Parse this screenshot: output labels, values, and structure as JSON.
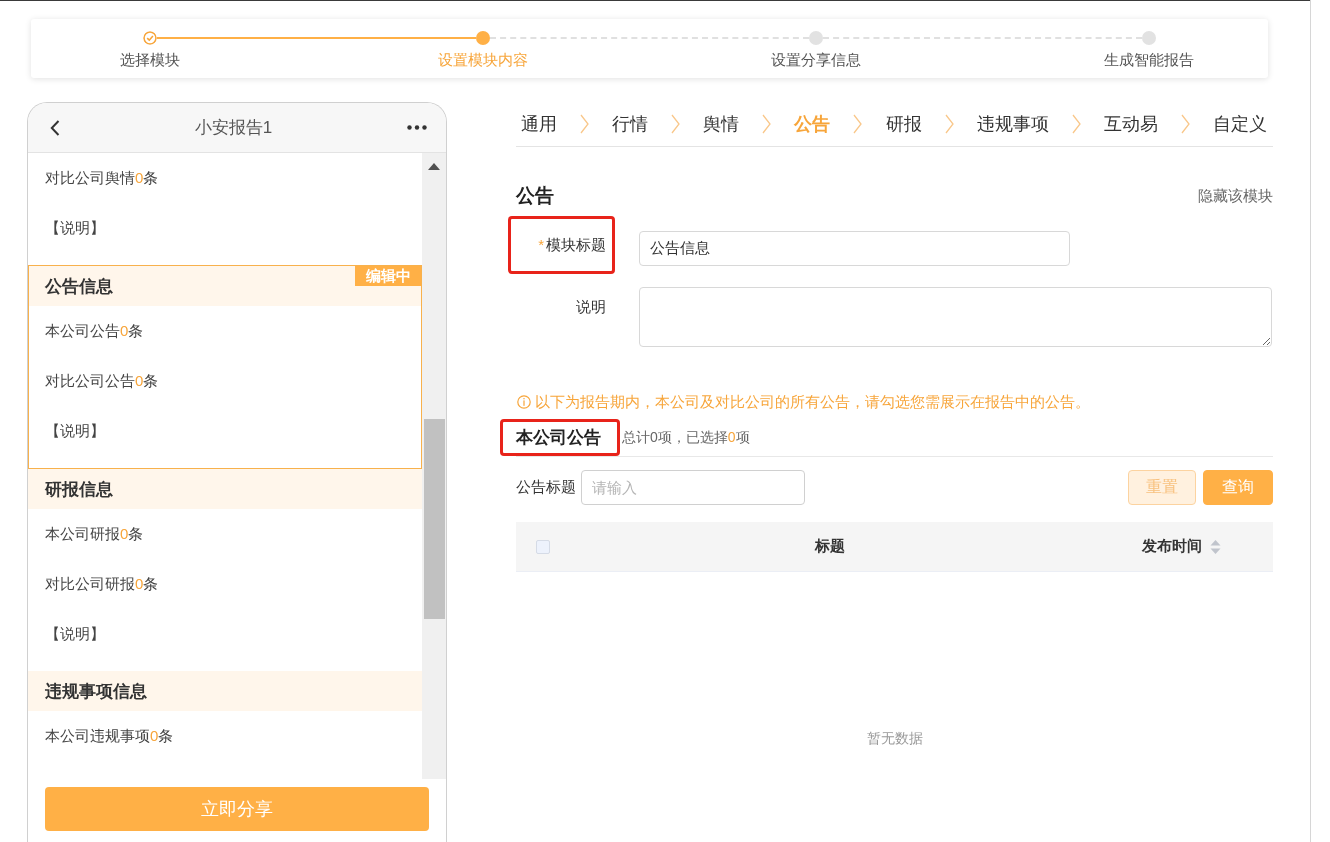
{
  "steps": [
    {
      "label": "选择模块",
      "completed": true,
      "selected": false
    },
    {
      "label": "设置模块内容",
      "completed": false,
      "selected": true
    },
    {
      "label": "设置分享信息",
      "completed": false,
      "selected": false
    },
    {
      "label": "生成智能报告",
      "completed": false,
      "selected": false
    }
  ],
  "preview": {
    "title": "小安报告1",
    "sections": [
      {
        "editing": false,
        "rows": [
          {
            "kind": "count",
            "label": "对比公司舆情",
            "count": "0",
            "unit": "条"
          },
          {
            "kind": "note",
            "text": "【说明】"
          }
        ]
      },
      {
        "title": "公告信息",
        "editing": true,
        "badge": "编辑中",
        "rows": [
          {
            "kind": "count",
            "label": "本公司公告",
            "count": "0",
            "unit": "条"
          },
          {
            "kind": "count",
            "label": "对比公司公告",
            "count": "0",
            "unit": "条"
          },
          {
            "kind": "note",
            "text": "【说明】"
          }
        ]
      },
      {
        "title": "研报信息",
        "editing": false,
        "rows": [
          {
            "kind": "count",
            "label": "本公司研报",
            "count": "0",
            "unit": "条"
          },
          {
            "kind": "count",
            "label": "对比公司研报",
            "count": "0",
            "unit": "条"
          },
          {
            "kind": "note",
            "text": "【说明】"
          }
        ]
      },
      {
        "title": "违规事项信息",
        "editing": false,
        "rows": [
          {
            "kind": "count",
            "label": "本公司违规事项",
            "count": "0",
            "unit": "条"
          }
        ]
      }
    ],
    "share_button": "立即分享"
  },
  "tabs": [
    {
      "label": "通用",
      "selected": false
    },
    {
      "label": "行情",
      "selected": false
    },
    {
      "label": "舆情",
      "selected": false
    },
    {
      "label": "公告",
      "selected": true
    },
    {
      "label": "研报",
      "selected": false
    },
    {
      "label": "违规事项",
      "selected": false
    },
    {
      "label": "互动易",
      "selected": false
    },
    {
      "label": "自定义",
      "selected": false
    }
  ],
  "module": {
    "title": "公告",
    "hide_link": "隐藏该模块",
    "fields": [
      {
        "kind": "input",
        "required_mark": "*",
        "label": "模块标题",
        "annotated": true,
        "value": "公告信息"
      },
      {
        "kind": "textarea",
        "label": "说明",
        "annotated": false
      }
    ]
  },
  "notice": "以下为报告期内，本公司及对比公司的所有公告，请勾选您需展示在报告中的公告。",
  "list": {
    "title": "本公司公告",
    "annotated": true,
    "summary": {
      "text": "总计0项，已选择",
      "count": "0",
      "unit": "项"
    },
    "filter": {
      "label": "公告标题",
      "placeholder": "请输入"
    },
    "buttons": [
      {
        "label": "重置",
        "kind": "plain"
      },
      {
        "label": "查询",
        "kind": "primary"
      }
    ],
    "select_all": {
      "checked": false
    },
    "columns": [
      {
        "label": "标题",
        "sortable": false
      },
      {
        "label": "发布时间",
        "sortable": true
      }
    ],
    "empty_text": "暂无数据"
  }
}
